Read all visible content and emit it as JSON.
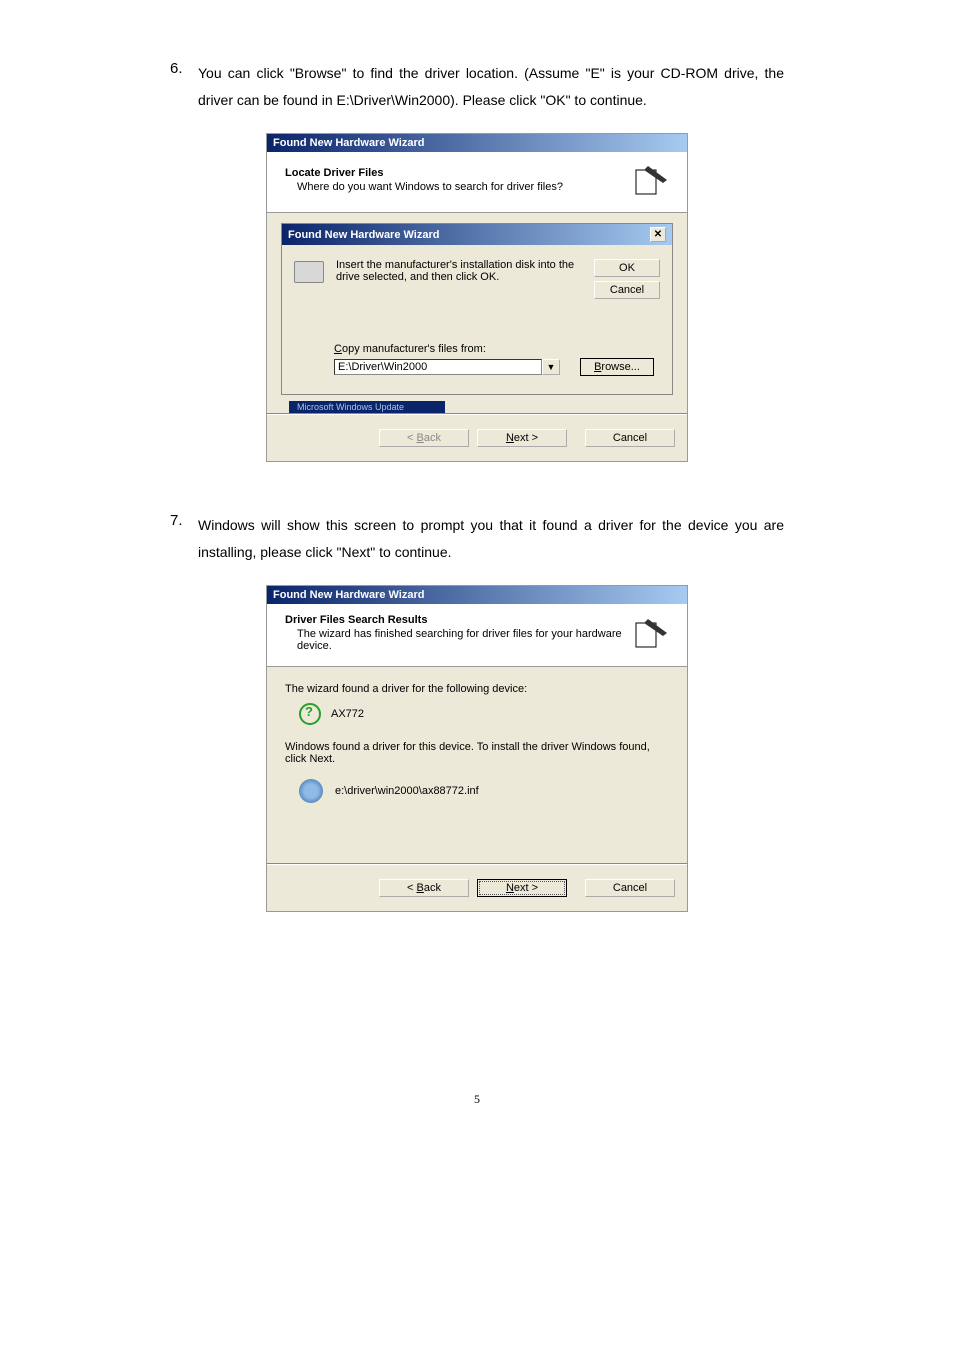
{
  "step6": {
    "num": "6.",
    "text": "You can click \"Browse\" to find the driver location. (Assume \"E\" is your CD-ROM drive, the driver can be found in E:\\Driver\\Win2000). Please click \"OK\" to continue."
  },
  "step7": {
    "num": "7.",
    "text": "Windows will show this screen to prompt you that it found a driver for the device you are installing, please click \"Next\" to continue."
  },
  "dlg1": {
    "title": "Found New Hardware Wizard",
    "header_title": "Locate Driver Files",
    "header_sub": "Where do you want Windows to search for driver files?",
    "inner_title": "Found New Hardware Wizard",
    "inner_msg": "Insert the manufacturer's installation disk into the drive selected, and then click OK.",
    "ok": "OK",
    "cancel": "Cancel",
    "copy_label": "Copy manufacturer's files from:",
    "path_value": "E:\\Driver\\Win2000",
    "browse": "Browse...",
    "faded": "Microsoft Windows Update",
    "back": "< Back",
    "next": "Next >",
    "footer_cancel": "Cancel"
  },
  "dlg2": {
    "title": "Found New Hardware Wizard",
    "header_title": "Driver Files Search Results",
    "header_sub": "The wizard has finished searching for driver files for your hardware device.",
    "found_text": "The wizard found a driver for the following device:",
    "device_name": "AX772",
    "install_text": "Windows found a driver for this device. To install the driver Windows found, click Next.",
    "inf_path": "e:\\driver\\win2000\\ax88772.inf",
    "back": "< Back",
    "next": "Next >",
    "footer_cancel": "Cancel"
  },
  "page_number": "5"
}
